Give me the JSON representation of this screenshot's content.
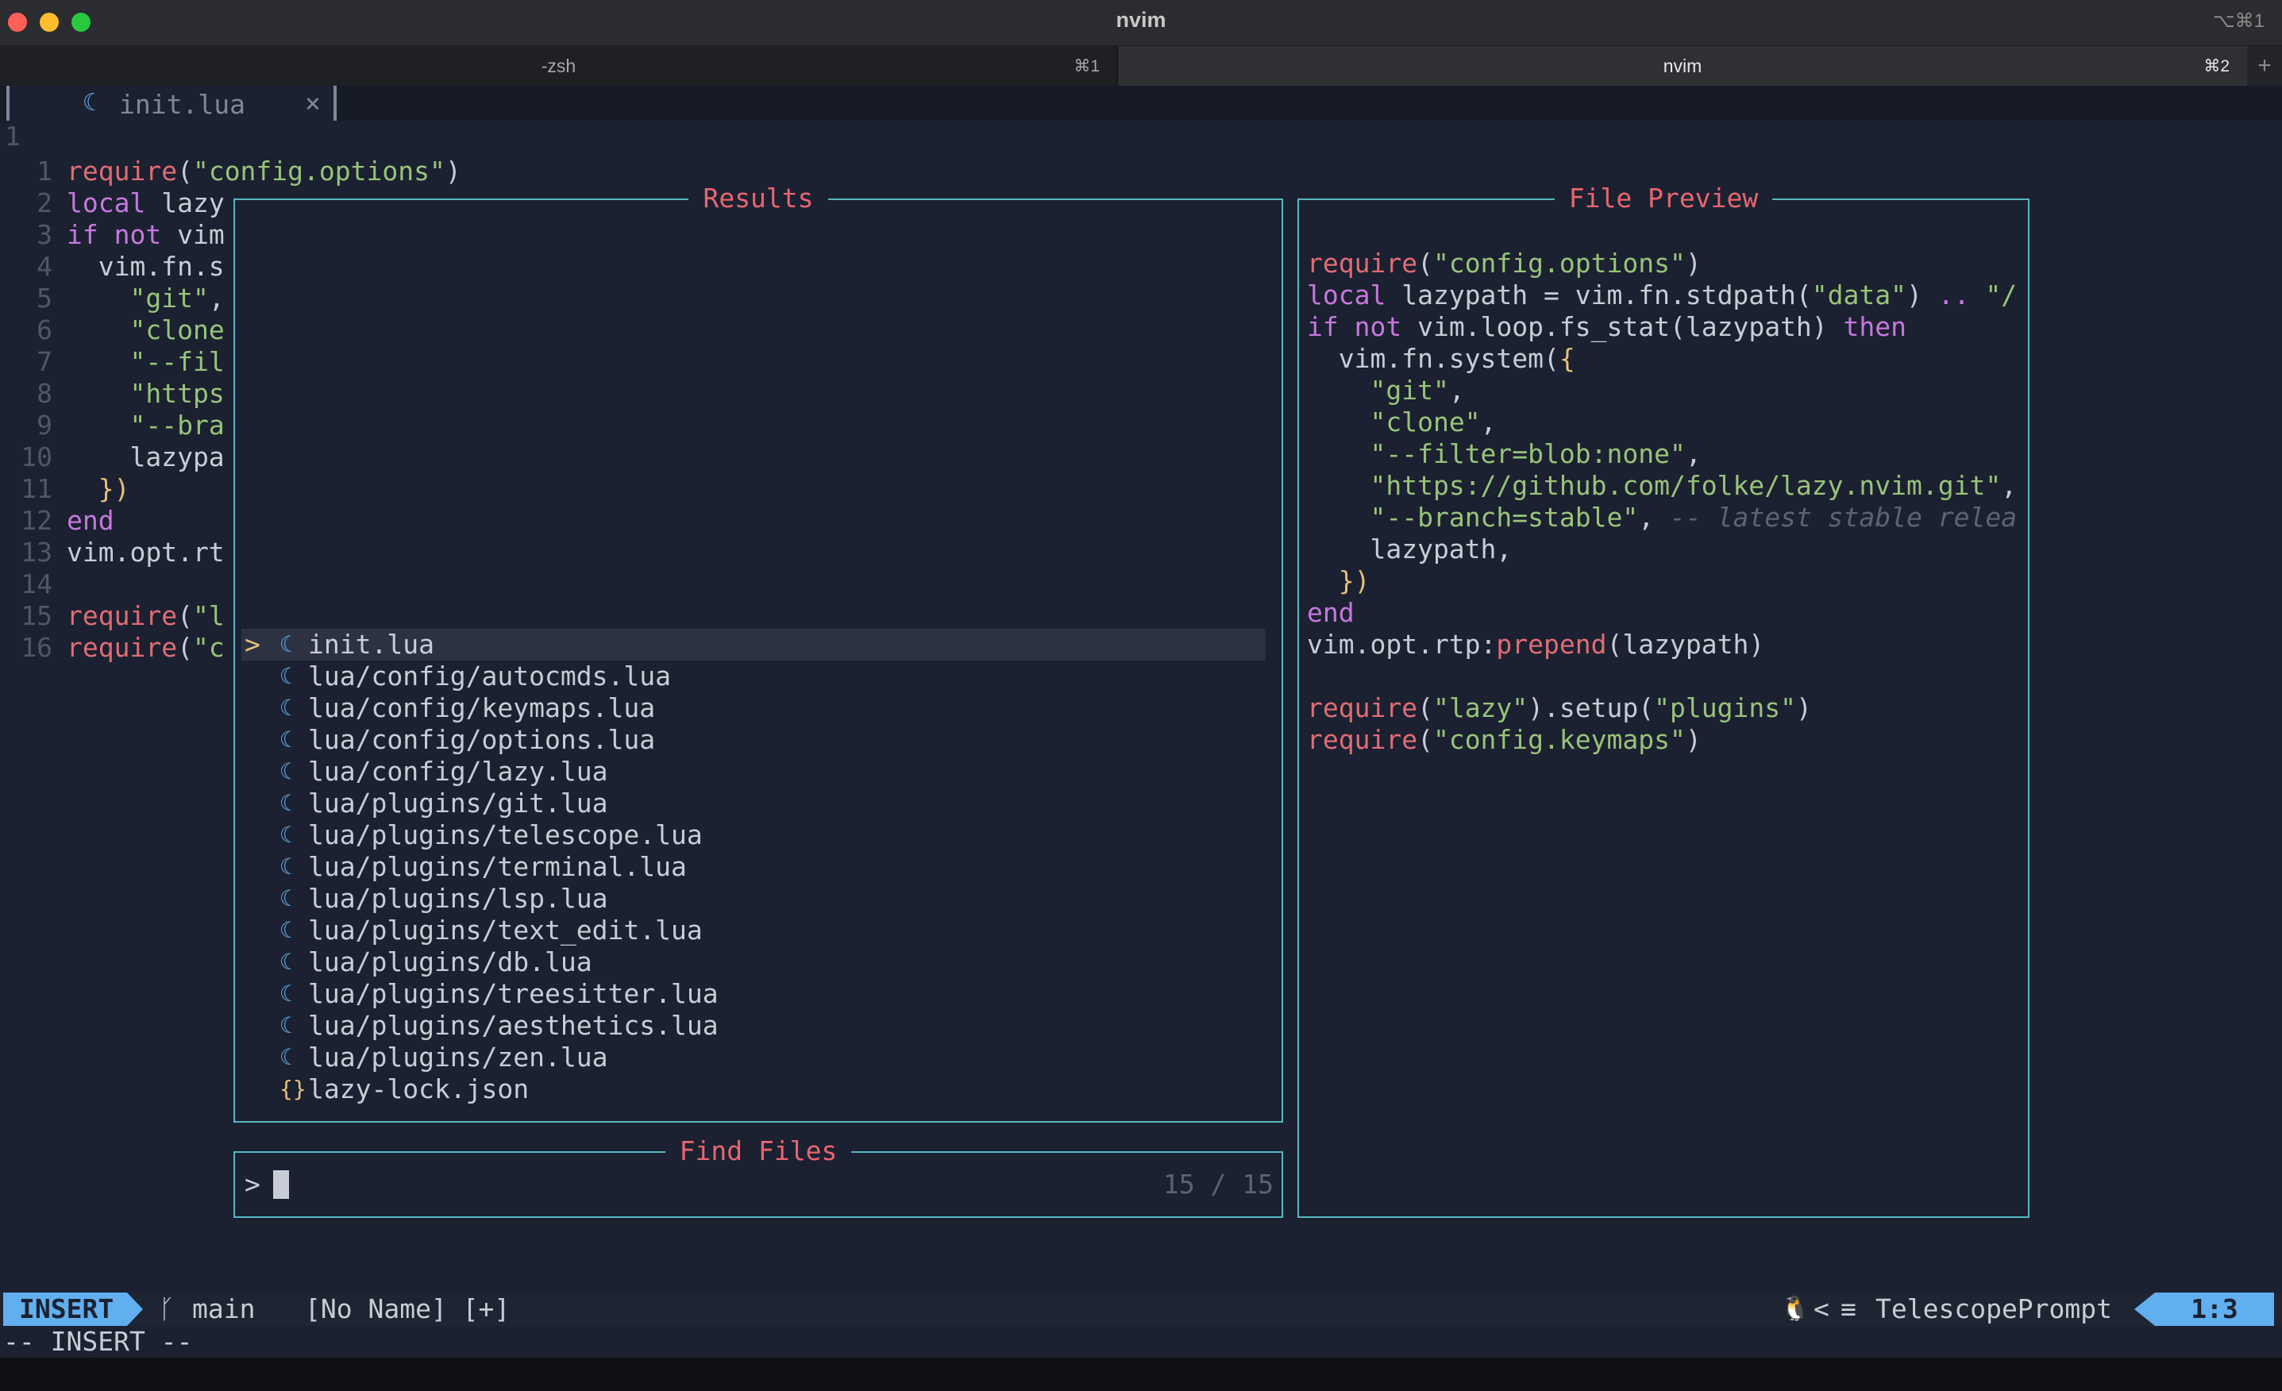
{
  "window": {
    "title": "nvim",
    "shortcut": "⌥⌘1",
    "controls": {
      "close_color": "#ff5f57",
      "minimize_color": "#febc2e",
      "zoom_color": "#28c840"
    }
  },
  "terminal_tabs": [
    {
      "name": "-zsh",
      "shortcut": "⌘1"
    },
    {
      "name": "nvim",
      "shortcut": "⌘2"
    }
  ],
  "terminal_add_label": "+",
  "bufferline": {
    "icon": "☾",
    "name": "init.lua",
    "close": "×"
  },
  "editor": {
    "top_line_number": "1",
    "lines": [
      {
        "n": "1",
        "parts": [
          {
            "t": "require",
            "c": "f"
          },
          {
            "t": "(",
            "c": ""
          },
          {
            "t": "\"config.options\"",
            "c": "s"
          },
          {
            "t": ")",
            "c": ""
          }
        ]
      },
      {
        "n": "2",
        "parts": [
          {
            "t": "local",
            "c": "k"
          },
          {
            "t": " lazy",
            "c": ""
          }
        ]
      },
      {
        "n": "3",
        "parts": [
          {
            "t": "if",
            "c": "k"
          },
          {
            "t": " ",
            "c": ""
          },
          {
            "t": "not",
            "c": "k"
          },
          {
            "t": " vim",
            "c": ""
          }
        ]
      },
      {
        "n": "4",
        "parts": [
          {
            "t": "  vim.fn.s",
            "c": ""
          }
        ]
      },
      {
        "n": "5",
        "parts": [
          {
            "t": "    ",
            "c": ""
          },
          {
            "t": "\"git\"",
            "c": "s"
          },
          {
            "t": ",",
            "c": ""
          }
        ]
      },
      {
        "n": "6",
        "parts": [
          {
            "t": "    ",
            "c": ""
          },
          {
            "t": "\"clone",
            "c": "s"
          }
        ]
      },
      {
        "n": "7",
        "parts": [
          {
            "t": "    ",
            "c": ""
          },
          {
            "t": "\"--fil",
            "c": "s"
          }
        ]
      },
      {
        "n": "8",
        "parts": [
          {
            "t": "    ",
            "c": ""
          },
          {
            "t": "\"https",
            "c": "s"
          }
        ]
      },
      {
        "n": "9",
        "parts": [
          {
            "t": "    ",
            "c": ""
          },
          {
            "t": "\"--bra",
            "c": "s"
          }
        ]
      },
      {
        "n": "10",
        "parts": [
          {
            "t": "    lazypa",
            "c": ""
          }
        ]
      },
      {
        "n": "11",
        "parts": [
          {
            "t": "  ",
            "c": ""
          },
          {
            "t": "})",
            "c": "y"
          }
        ]
      },
      {
        "n": "12",
        "parts": [
          {
            "t": "end",
            "c": "k"
          }
        ]
      },
      {
        "n": "13",
        "parts": [
          {
            "t": "vim.opt.rt",
            "c": ""
          }
        ]
      },
      {
        "n": "14",
        "parts": []
      },
      {
        "n": "15",
        "parts": [
          {
            "t": "require",
            "c": "f"
          },
          {
            "t": "(",
            "c": ""
          },
          {
            "t": "\"l",
            "c": "s"
          }
        ]
      },
      {
        "n": "16",
        "parts": [
          {
            "t": "require",
            "c": "f"
          },
          {
            "t": "(",
            "c": ""
          },
          {
            "t": "\"c",
            "c": "s"
          }
        ]
      }
    ]
  },
  "telescope": {
    "results_title": "Results",
    "preview_title": "File Preview",
    "prompt_title": "Find Files",
    "prompt_prefix": ">",
    "prompt_value": "",
    "counter": "15 / 15",
    "selection_caret": ">",
    "results": [
      {
        "icon": "☾",
        "type": "lua",
        "name": "init.lua",
        "selected": true
      },
      {
        "icon": "☾",
        "type": "lua",
        "name": "lua/config/autocmds.lua"
      },
      {
        "icon": "☾",
        "type": "lua",
        "name": "lua/config/keymaps.lua"
      },
      {
        "icon": "☾",
        "type": "lua",
        "name": "lua/config/options.lua"
      },
      {
        "icon": "☾",
        "type": "lua",
        "name": "lua/config/lazy.lua"
      },
      {
        "icon": "☾",
        "type": "lua",
        "name": "lua/plugins/git.lua"
      },
      {
        "icon": "☾",
        "type": "lua",
        "name": "lua/plugins/telescope.lua"
      },
      {
        "icon": "☾",
        "type": "lua",
        "name": "lua/plugins/terminal.lua"
      },
      {
        "icon": "☾",
        "type": "lua",
        "name": "lua/plugins/lsp.lua"
      },
      {
        "icon": "☾",
        "type": "lua",
        "name": "lua/plugins/text_edit.lua"
      },
      {
        "icon": "☾",
        "type": "lua",
        "name": "lua/plugins/db.lua"
      },
      {
        "icon": "☾",
        "type": "lua",
        "name": "lua/plugins/treesitter.lua"
      },
      {
        "icon": "☾",
        "type": "lua",
        "name": "lua/plugins/aesthetics.lua"
      },
      {
        "icon": "☾",
        "type": "lua",
        "name": "lua/plugins/zen.lua"
      },
      {
        "icon": "{}",
        "type": "json",
        "name": "lazy-lock.json"
      }
    ],
    "preview_lines": [
      [
        {
          "t": "require",
          "c": "f"
        },
        {
          "t": "(",
          "c": ""
        },
        {
          "t": "\"config.options\"",
          "c": "s"
        },
        {
          "t": ")",
          "c": ""
        }
      ],
      [
        {
          "t": "local",
          "c": "k"
        },
        {
          "t": " lazypath = vim.fn.stdpath(",
          "c": ""
        },
        {
          "t": "\"data\"",
          "c": "s"
        },
        {
          "t": ") ",
          "c": ""
        },
        {
          "t": "..",
          "c": "k"
        },
        {
          "t": " ",
          "c": ""
        },
        {
          "t": "\"/",
          "c": "s"
        }
      ],
      [
        {
          "t": "if",
          "c": "k"
        },
        {
          "t": " ",
          "c": ""
        },
        {
          "t": "not",
          "c": "k"
        },
        {
          "t": " vim.loop.fs_stat(lazypath) ",
          "c": ""
        },
        {
          "t": "then",
          "c": "k"
        }
      ],
      [
        {
          "t": "  vim.fn.system(",
          "c": ""
        },
        {
          "t": "{",
          "c": "y"
        }
      ],
      [
        {
          "t": "    ",
          "c": ""
        },
        {
          "t": "\"git\"",
          "c": "s"
        },
        {
          "t": ",",
          "c": ""
        }
      ],
      [
        {
          "t": "    ",
          "c": ""
        },
        {
          "t": "\"clone\"",
          "c": "s"
        },
        {
          "t": ",",
          "c": ""
        }
      ],
      [
        {
          "t": "    ",
          "c": ""
        },
        {
          "t": "\"--filter=blob:none\"",
          "c": "s"
        },
        {
          "t": ",",
          "c": ""
        }
      ],
      [
        {
          "t": "    ",
          "c": ""
        },
        {
          "t": "\"https://github.com/folke/lazy.nvim.git\"",
          "c": "s"
        },
        {
          "t": ",",
          "c": ""
        }
      ],
      [
        {
          "t": "    ",
          "c": ""
        },
        {
          "t": "\"--branch=stable\"",
          "c": "s"
        },
        {
          "t": ", ",
          "c": ""
        },
        {
          "t": "-- latest stable relea",
          "c": "c"
        }
      ],
      [
        {
          "t": "    lazypath,",
          "c": ""
        }
      ],
      [
        {
          "t": "  ",
          "c": ""
        },
        {
          "t": "})",
          "c": "y"
        }
      ],
      [
        {
          "t": "end",
          "c": "k"
        }
      ],
      [
        {
          "t": "vim.opt.rtp:",
          "c": ""
        },
        {
          "t": "prepend",
          "c": "f"
        },
        {
          "t": "(lazypath)",
          "c": ""
        }
      ],
      [],
      [
        {
          "t": "require",
          "c": "f"
        },
        {
          "t": "(",
          "c": ""
        },
        {
          "t": "\"lazy\"",
          "c": "s"
        },
        {
          "t": ").setup(",
          "c": ""
        },
        {
          "t": "\"plugins\"",
          "c": "s"
        },
        {
          "t": ")",
          "c": ""
        }
      ],
      [
        {
          "t": "require",
          "c": "f"
        },
        {
          "t": "(",
          "c": ""
        },
        {
          "t": "\"config.keymaps\"",
          "c": "s"
        },
        {
          "t": ")",
          "c": ""
        }
      ]
    ]
  },
  "statusline": {
    "mode": "INSERT",
    "branch_icon": "ᚴ",
    "branch": "main",
    "separator": "",
    "filename": "[No Name] [+]",
    "os_icon": "🐧",
    "separator_right": "<",
    "filetype_icon": "≡",
    "filetype": "TelescopePrompt",
    "position": "1:3"
  },
  "cmdline": "-- INSERT --",
  "colors": {
    "background": "#1b2130",
    "border": "#56b6c2",
    "accent": "#61afef",
    "title": "#e86671"
  }
}
